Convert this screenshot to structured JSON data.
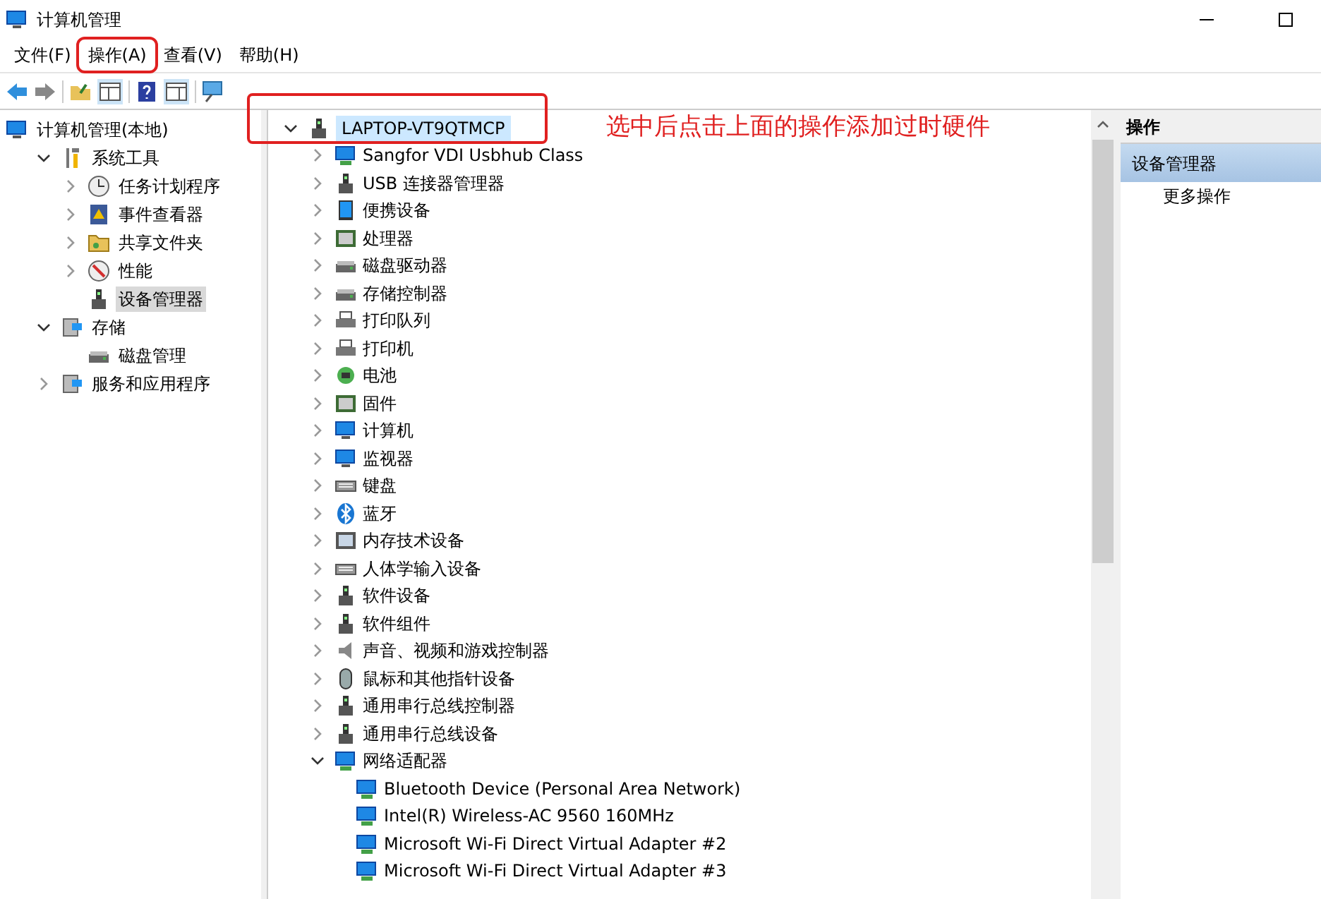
{
  "window": {
    "title": "计算机管理"
  },
  "menu": [
    {
      "label": "文件(F)",
      "highlighted": false
    },
    {
      "label": "操作(A)",
      "highlighted": true
    },
    {
      "label": "查看(V)",
      "highlighted": false
    },
    {
      "label": "帮助(H)",
      "highlighted": false
    }
  ],
  "sidebar": {
    "items": [
      {
        "label": "计算机管理(本地)",
        "kind": "computer",
        "selected": false,
        "children": [
          {
            "label": "系统工具",
            "kind": "tools",
            "expanded": true,
            "selected": false,
            "children": [
              {
                "label": "任务计划程序",
                "kind": "clock",
                "expanded": false,
                "selected": false
              },
              {
                "label": "事件查看器",
                "kind": "book",
                "expanded": false,
                "selected": false
              },
              {
                "label": "共享文件夹",
                "kind": "folder",
                "expanded": false,
                "selected": false
              },
              {
                "label": "性能",
                "kind": "gauge",
                "expanded": false,
                "selected": false
              },
              {
                "label": "设备管理器",
                "kind": "device",
                "selected": true
              }
            ]
          },
          {
            "label": "存储",
            "kind": "storage",
            "expanded": true,
            "selected": false,
            "children": [
              {
                "label": "磁盘管理",
                "kind": "disk",
                "selected": false
              }
            ]
          },
          {
            "label": "服务和应用程序",
            "kind": "services",
            "expanded": false,
            "selected": false
          }
        ]
      }
    ]
  },
  "device_tree": {
    "root": {
      "label": "LAPTOP-VT9QTMCP",
      "selected": true,
      "expanded": true
    },
    "items": [
      {
        "label": "Sangfor VDI Usbhub Class",
        "kind": "net",
        "expanded": false
      },
      {
        "label": "USB 连接器管理器",
        "kind": "usb",
        "expanded": false
      },
      {
        "label": "便携设备",
        "kind": "portable",
        "expanded": false
      },
      {
        "label": "处理器",
        "kind": "chip",
        "expanded": false
      },
      {
        "label": "磁盘驱动器",
        "kind": "disk",
        "expanded": false
      },
      {
        "label": "存储控制器",
        "kind": "disk",
        "expanded": false
      },
      {
        "label": "打印队列",
        "kind": "printer",
        "expanded": false
      },
      {
        "label": "打印机",
        "kind": "printer",
        "expanded": false
      },
      {
        "label": "电池",
        "kind": "battery",
        "expanded": false
      },
      {
        "label": "固件",
        "kind": "chip",
        "expanded": false
      },
      {
        "label": "计算机",
        "kind": "monitor",
        "expanded": false
      },
      {
        "label": "监视器",
        "kind": "monitor",
        "expanded": false
      },
      {
        "label": "键盘",
        "kind": "keyboard",
        "expanded": false
      },
      {
        "label": "蓝牙",
        "kind": "bluetooth",
        "expanded": false
      },
      {
        "label": "内存技术设备",
        "kind": "memory",
        "expanded": false
      },
      {
        "label": "人体学输入设备",
        "kind": "keyboard",
        "expanded": false
      },
      {
        "label": "软件设备",
        "kind": "usb",
        "expanded": false
      },
      {
        "label": "软件组件",
        "kind": "usb",
        "expanded": false
      },
      {
        "label": "声音、视频和游戏控制器",
        "kind": "speaker",
        "expanded": false
      },
      {
        "label": "鼠标和其他指针设备",
        "kind": "mouse",
        "expanded": false
      },
      {
        "label": "通用串行总线控制器",
        "kind": "usb",
        "expanded": false
      },
      {
        "label": "通用串行总线设备",
        "kind": "usb",
        "expanded": false
      },
      {
        "label": "网络适配器",
        "kind": "net",
        "expanded": true,
        "children": [
          {
            "label": "Bluetooth Device (Personal Area Network)",
            "kind": "net"
          },
          {
            "label": "Intel(R) Wireless-AC 9560 160MHz",
            "kind": "net"
          },
          {
            "label": "Microsoft Wi-Fi Direct Virtual Adapter #2",
            "kind": "net"
          },
          {
            "label": "Microsoft Wi-Fi Direct Virtual Adapter #3",
            "kind": "net"
          }
        ]
      }
    ]
  },
  "annotation": {
    "text": "选中后点击上面的操作添加过时硬件"
  },
  "actions_pane": {
    "title": "操作",
    "section": "设备管理器",
    "items": [
      "更多操作"
    ]
  }
}
